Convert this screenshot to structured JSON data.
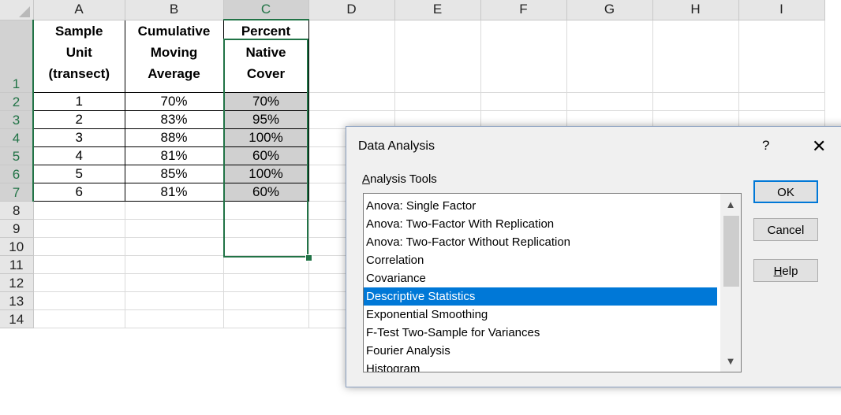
{
  "sheet": {
    "columns": [
      "A",
      "B",
      "C",
      "D",
      "E",
      "F",
      "G",
      "H",
      "I"
    ],
    "selected_column": "C",
    "rows": [
      "1",
      "2",
      "3",
      "4",
      "5",
      "6",
      "7",
      "8",
      "9",
      "10",
      "11",
      "12",
      "13",
      "14"
    ],
    "headers": {
      "a": [
        "Sample",
        "Unit",
        "(transect)"
      ],
      "b": [
        "Cumulative",
        "Moving",
        "Average"
      ],
      "c": [
        "Percent",
        "Native",
        "Cover"
      ]
    },
    "data": [
      [
        "1",
        "70%",
        "70%"
      ],
      [
        "2",
        "83%",
        "95%"
      ],
      [
        "3",
        "88%",
        "100%"
      ],
      [
        "4",
        "81%",
        "60%"
      ],
      [
        "5",
        "85%",
        "100%"
      ],
      [
        "6",
        "81%",
        "60%"
      ]
    ]
  },
  "dialog": {
    "title": "Data Analysis",
    "help_glyph": "?",
    "close_glyph": "✕",
    "tools_label_first": "A",
    "tools_label_rest": "nalysis Tools",
    "items": [
      "Anova: Single Factor",
      "Anova: Two-Factor With Replication",
      "Anova: Two-Factor Without Replication",
      "Correlation",
      "Covariance",
      "Descriptive Statistics",
      "Exponential Smoothing",
      "F-Test Two-Sample for Variances",
      "Fourier Analysis",
      "Histogram"
    ],
    "selected_item": "Descriptive Statistics",
    "scroll_up_glyph": "▲",
    "scroll_down_glyph": "▼",
    "ok_label": "OK",
    "cancel_label": "Cancel",
    "help_first": "H",
    "help_rest": "elp"
  }
}
